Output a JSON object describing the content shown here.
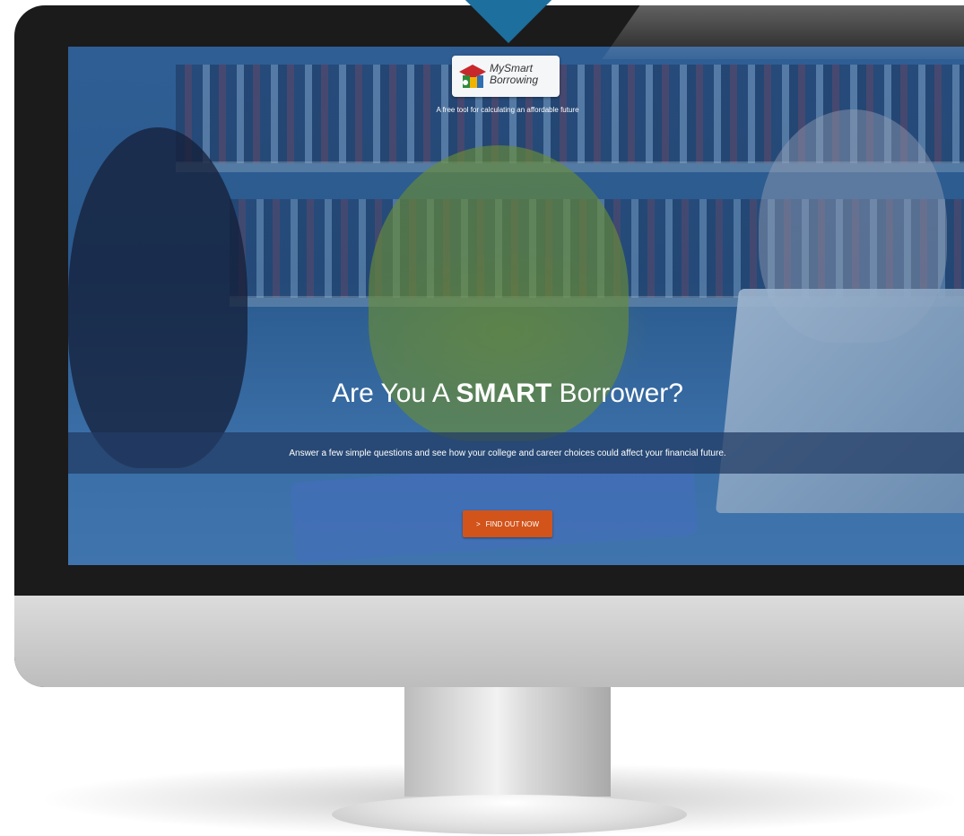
{
  "header": {
    "logo": {
      "line1": "MySmart",
      "line2": "Borrowing",
      "icon": "graduation-cap-logo-icon"
    },
    "tagline": "A free tool for calculating an affordable future"
  },
  "hero": {
    "headline_prefix": "Are You A",
    "headline_emphasis": "SMART",
    "headline_suffix": "Borrower?",
    "subline": "Answer a few simple questions and see how your college and career choices could affect your financial future."
  },
  "cta": {
    "chevron": ">",
    "label": "FIND OUT NOW"
  },
  "colors": {
    "accent_orange": "#d2541b",
    "pointer_blue": "#1d6f9e",
    "overlay_blue": "#2f5e94"
  }
}
